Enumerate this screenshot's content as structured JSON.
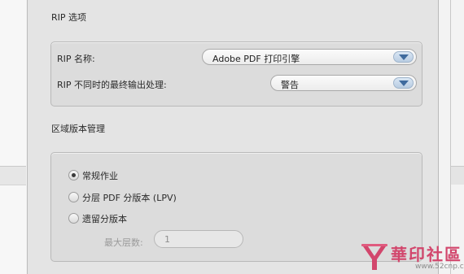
{
  "rip_section": {
    "title": "RIP 选项",
    "name_label": "RIP 名称:",
    "name_value": "Adobe PDF 打印引擎",
    "mismatch_label": "RIP 不同时的最终输出处理:",
    "mismatch_value": "警告"
  },
  "region_section": {
    "title": "区域版本管理",
    "options": [
      {
        "label": "常规作业",
        "selected": true
      },
      {
        "label": "分层 PDF 分版本 (LPV)",
        "selected": false
      },
      {
        "label": "遗留分版本",
        "selected": false
      }
    ],
    "max_layers_label": "最大层数:",
    "max_layers_value": "1"
  },
  "watermark": {
    "text": "華印社區",
    "url": "www.52cnp.com"
  },
  "colors": {
    "panel_bg": "#e4e4e4",
    "group_bg": "#dcdcdc",
    "dropdown_arrow_bg": "#c7d7ea",
    "dropdown_arrow_icon": "#3f6b9e",
    "watermark": "#d2466c"
  },
  "icons": {
    "dropdown": "chevron-down-icon",
    "watermark_logo": "printer-logo-icon"
  }
}
